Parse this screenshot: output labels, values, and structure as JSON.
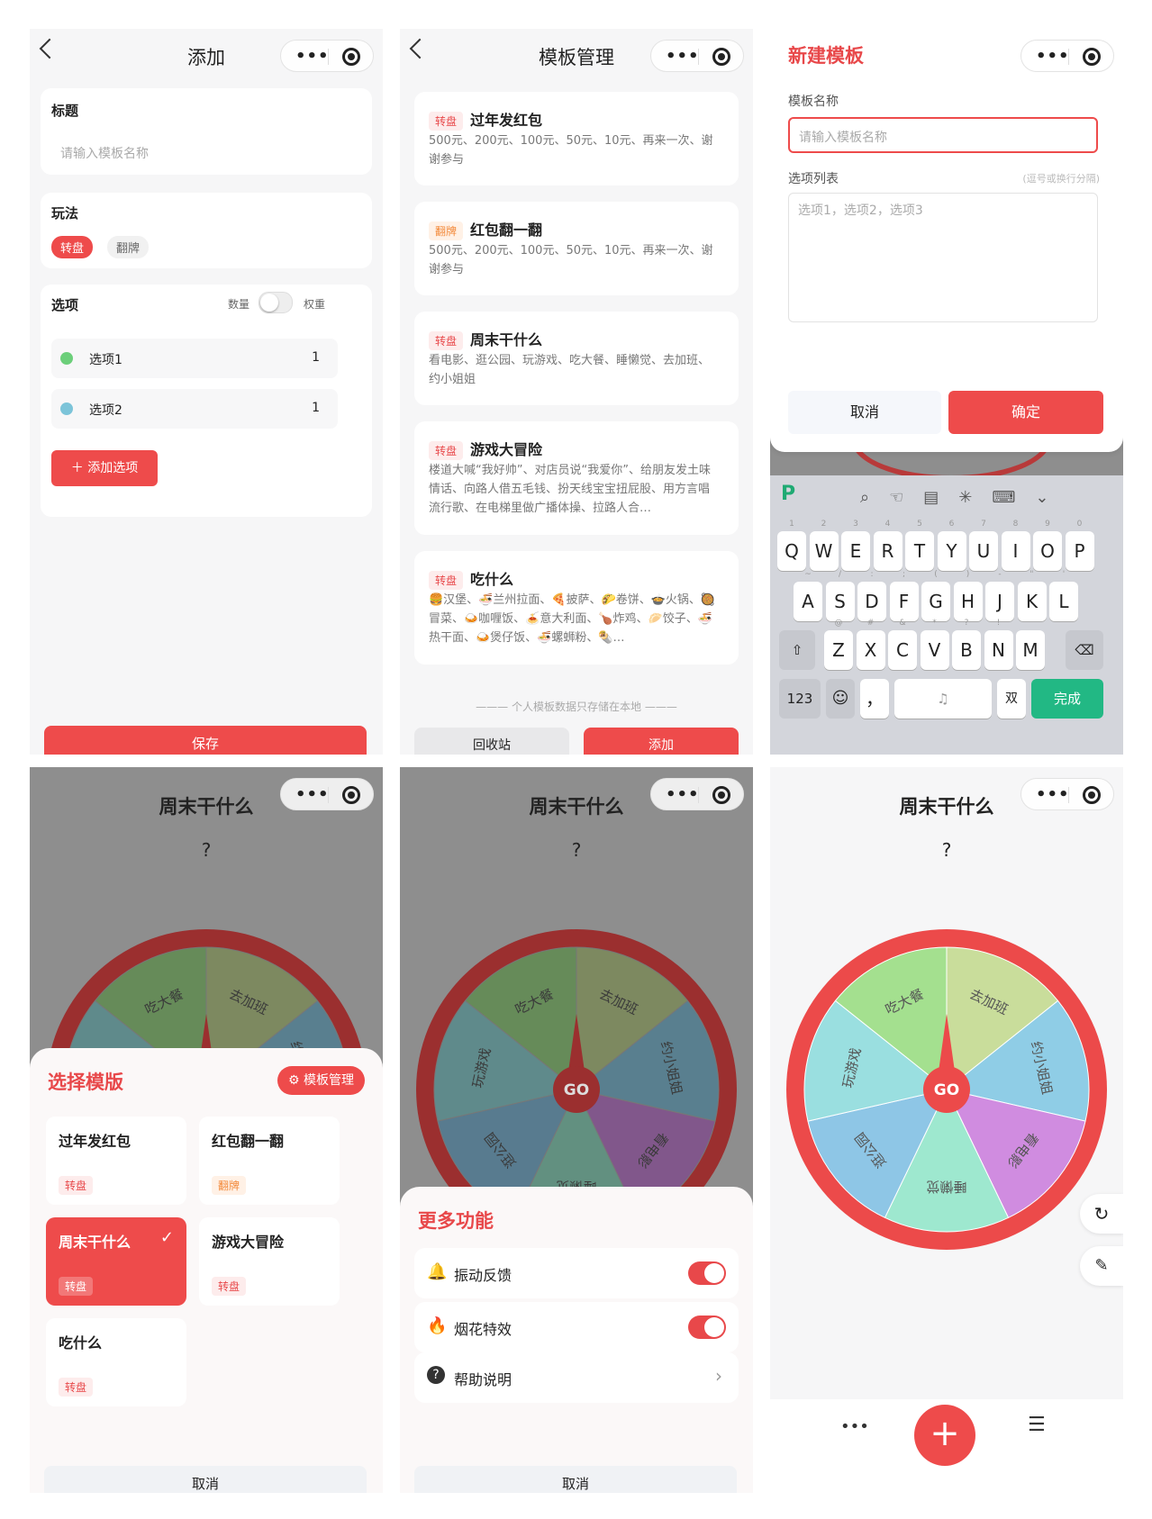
{
  "p1": {
    "title": "添加",
    "label_title": "标题",
    "placeholder_title": "请输入模板名称",
    "label_mode": "玩法",
    "mode_active": "转盘",
    "mode_other": "翻牌",
    "label_options": "选项",
    "label_count": "数量",
    "label_weight": "权重",
    "options": [
      {
        "name": "选项1",
        "value": "1",
        "color": "#6ccf7a"
      },
      {
        "name": "选项2",
        "value": "1",
        "color": "#7cc4d9"
      }
    ],
    "add_option": "添加选项",
    "save": "保存"
  },
  "p2": {
    "title": "模板管理",
    "templates": [
      {
        "tag": "转盘",
        "name": "过年发红包",
        "desc": "500元、200元、100元、50元、10元、再来一次、谢谢参与"
      },
      {
        "tag": "翻牌",
        "name": "红包翻一翻",
        "desc": "500元、200元、100元、50元、10元、再来一次、谢谢参与"
      },
      {
        "tag": "转盘",
        "name": "周末干什么",
        "desc": "看电影、逛公园、玩游戏、吃大餐、睡懒觉、去加班、约小姐姐"
      },
      {
        "tag": "转盘",
        "name": "游戏大冒险",
        "desc": "楼道大喊“我好帅”、对店员说“我爱你”、给朋友发土味情话、向路人借五毛钱、扮天线宝宝扭屁股、用方言唱流行歌、在电梯里做广播体操、拉路人合…"
      },
      {
        "tag": "转盘",
        "name": "吃什么",
        "desc": "🍔汉堡、🍜兰州拉面、🍕披萨、🌮卷饼、🍲火锅、🥘冒菜、🍛咖喱饭、🍝意大利面、🍗炸鸡、🥟饺子、🍜热干面、🍛煲仔饭、🍜螺蛳粉、🌯…"
      }
    ],
    "footer_note": "个人模板数据只存储在本地",
    "recycle": "回收站",
    "add": "添加"
  },
  "p3": {
    "title": "新建模板",
    "label_name": "模板名称",
    "placeholder_name": "请输入模板名称",
    "label_list": "选项列表",
    "hint_list": "(逗号或换行分隔)",
    "placeholder_list": "选项1，选项2，选项3",
    "cancel": "取消",
    "confirm": "确定",
    "kb_row1": [
      "Q",
      "W",
      "E",
      "R",
      "T",
      "Y",
      "U",
      "I",
      "O",
      "P"
    ],
    "kb_row1_sub": [
      "1",
      "2",
      "3",
      "4",
      "5",
      "6",
      "7",
      "8",
      "9",
      "0"
    ],
    "kb_row2": [
      "A",
      "S",
      "D",
      "F",
      "G",
      "H",
      "J",
      "K",
      "L"
    ],
    "kb_row2_sub": [
      "~",
      "/",
      ":",
      ";",
      "(",
      ")",
      "-",
      "\"",
      "'"
    ],
    "kb_row3": [
      "Z",
      "X",
      "C",
      "V",
      "B",
      "N",
      "M"
    ],
    "kb_row3_sub": [
      "@",
      "#",
      "&",
      "*",
      "?",
      "!",
      ""
    ],
    "kb_num": "123",
    "kb_comma": "，",
    "kb_lang": "双",
    "kb_done": "完成"
  },
  "wheel": {
    "title": "周末干什么",
    "result": "?",
    "go": "GO",
    "segments": [
      {
        "label": "吃大餐",
        "color": "#a4e08f"
      },
      {
        "label": "去加班",
        "color": "#c9dd9b"
      },
      {
        "label": "约小姐姐",
        "color": "#8fcde6"
      },
      {
        "label": "看电影",
        "color": "#d08ce0"
      },
      {
        "label": "睡懒觉",
        "color": "#9ee8cf"
      },
      {
        "label": "逛公园",
        "color": "#8ec6e6"
      },
      {
        "label": "玩游戏",
        "color": "#9adfe0"
      }
    ]
  },
  "p4": {
    "sheet_title": "选择模版",
    "manage": "模板管理",
    "items": [
      {
        "name": "过年发红包",
        "tag": "转盘"
      },
      {
        "name": "红包翻一翻",
        "tag": "翻牌"
      },
      {
        "name": "周末干什么",
        "tag": "转盘",
        "selected": true
      },
      {
        "name": "游戏大冒险",
        "tag": "转盘"
      },
      {
        "name": "吃什么",
        "tag": "转盘"
      }
    ],
    "cancel": "取消"
  },
  "p5": {
    "sheet_title": "更多功能",
    "vibration": "振动反馈",
    "fireworks": "烟花特效",
    "help": "帮助说明",
    "cancel": "取消"
  }
}
